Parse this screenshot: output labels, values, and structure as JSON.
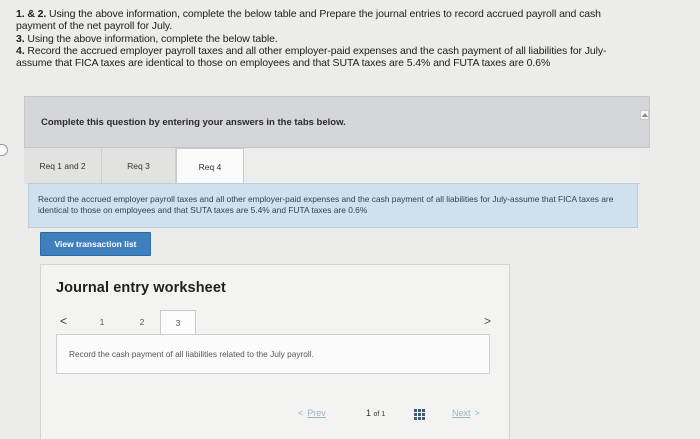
{
  "instructions": {
    "line1_num": "1. & 2.",
    "line1_text": " Using the above information, complete the below table and Prepare the journal entries to record accrued payroll and cash",
    "line2_text": "payment of the net payroll for July.",
    "line3_num": "3.",
    "line3_text": " Using the above information, complete the below table.",
    "line4_num": "4.",
    "line4_text": " Record the accrued employer payroll taxes and all other employer-paid expenses and the cash payment of all liabilities for July-",
    "line5_text": "assume that FICA taxes are identical to those on employees and that SUTA taxes are 5.4% and FUTA taxes are 0.6%"
  },
  "panel": {
    "header": "Complete this question by entering your answers in the tabs below."
  },
  "tabs": [
    {
      "label": "Req 1 and 2"
    },
    {
      "label": "Req 3"
    },
    {
      "label": "Req 4"
    }
  ],
  "requirement": {
    "text": "Record the accrued employer payroll taxes and all other employer-paid expenses and the cash payment of all liabilities for July-assume that FICA taxes are identical to those on employees and that SUTA taxes are 5.4% and FUTA taxes are 0.6%"
  },
  "view_button": "View transaction list",
  "worksheet": {
    "title": "Journal entry worksheet",
    "prev_arrow": "<",
    "next_arrow": ">",
    "numbers": [
      "1",
      "2",
      "3"
    ],
    "content": "Record the cash payment of all liabilities related to the July payroll."
  },
  "pager": {
    "prev_arrow": "<",
    "prev": "Prev",
    "page": "1",
    "of": "of 1",
    "next": "Next",
    "next_arrow": ">"
  },
  "icons": {
    "grid": "grid-icon",
    "scroll_up": "chevron-up-icon"
  },
  "colors": {
    "accent": "#3f7fbe",
    "req_box": "#cfe1ee",
    "panel_header": "#d5d6da"
  }
}
